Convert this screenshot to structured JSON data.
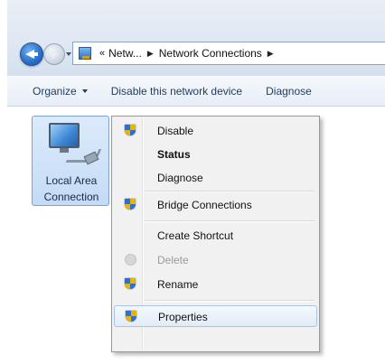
{
  "address": {
    "overflow": "«",
    "segments": [
      "Netw...",
      "Network Connections"
    ],
    "separator": "▶"
  },
  "toolbar": {
    "organize": "Organize",
    "disable_device": "Disable this network device",
    "diagnose": "Diagnose"
  },
  "connection": {
    "label_line1": "Local Area",
    "label_line2": "Connection"
  },
  "menu": {
    "items": [
      {
        "label": "Disable",
        "icon": "uac-shield-icon"
      },
      {
        "label": "Status",
        "icon": null
      },
      {
        "label": "Diagnose",
        "icon": null
      },
      {
        "label": "Bridge Connections",
        "icon": "uac-shield-icon"
      },
      {
        "label": "Create Shortcut",
        "icon": null
      },
      {
        "label": "Delete",
        "icon": "uac-shield-icon"
      },
      {
        "label": "Rename",
        "icon": "uac-shield-icon"
      },
      {
        "label": "Properties",
        "icon": "uac-shield-icon"
      }
    ]
  },
  "colors": {
    "selection_fill": "#c4dbf6",
    "selection_border": "#7da2ce",
    "toolbar_text": "#1e3a5f"
  }
}
